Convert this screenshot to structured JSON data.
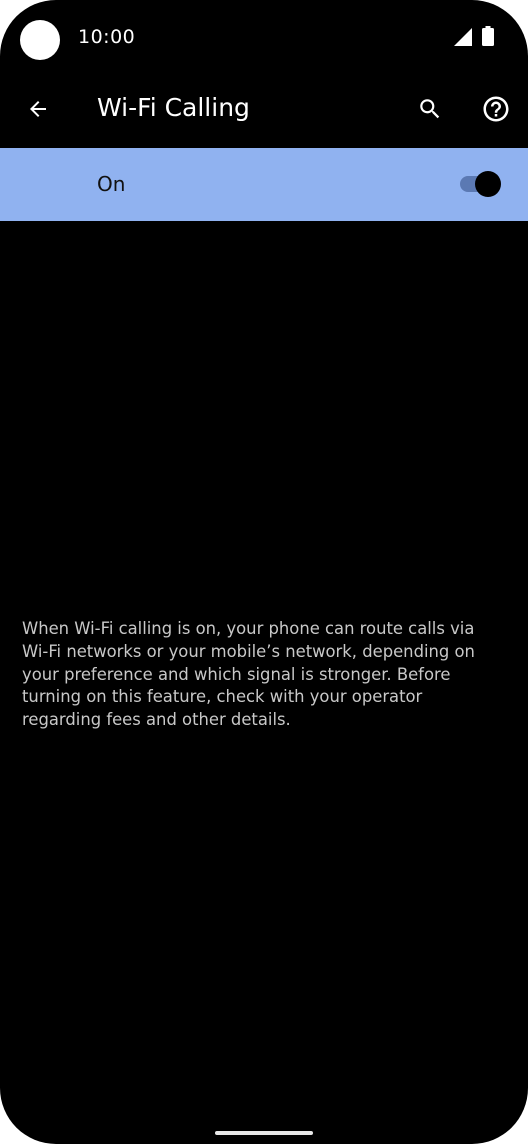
{
  "status_bar": {
    "time": "10:00"
  },
  "app_bar": {
    "title": "Wi-Fi Calling",
    "back_icon": "arrow-back-icon",
    "search_icon": "search-icon",
    "help_icon": "help-icon"
  },
  "main_switch": {
    "label": "On",
    "checked": true
  },
  "description": "When Wi-Fi calling is on, your phone can route calls via Wi-Fi networks or your mobile’s network, depending on your preference and which signal is stronger. Before turning on this feature, check with your operator regarding fees and other details.",
  "colors": {
    "switch_bar_background": "#90b2f0",
    "toggle_track": "#5b79b3",
    "background": "#000000",
    "description_text": "#c8c8c8"
  }
}
